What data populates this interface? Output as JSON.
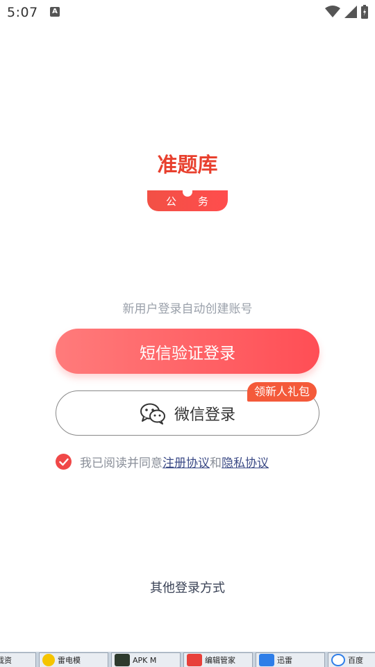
{
  "status_bar": {
    "time": "5:07",
    "notification_icon": "A"
  },
  "logo": {
    "title": "准题库",
    "tag_left": "公",
    "tag_right": "务"
  },
  "hint": "新用户登录自动创建账号",
  "sms_login_label": "短信验证登录",
  "wechat_login_label": "微信登录",
  "gift_badge": "领新人礼包",
  "agreement": {
    "prefix": "我已阅读并同意",
    "register_link": "注册协议",
    "and": "和",
    "privacy_link": "隐私协议"
  },
  "other_login": "其他登录方式",
  "taskbar": {
    "items": [
      {
        "label": "载资",
        "icon": "app-icon"
      },
      {
        "label": "雷电模",
        "icon": "ldplayer-icon"
      },
      {
        "label": "APK M",
        "icon": "android-icon"
      },
      {
        "label": "编辑管家",
        "icon": "red-app-icon"
      },
      {
        "label": "迅雷",
        "icon": "xunlei-icon"
      },
      {
        "label": "百度",
        "icon": "cloud-icon"
      }
    ]
  },
  "colors": {
    "accent": "#ff4e55",
    "badge": "#f45a3a",
    "link": "#3b4a86"
  }
}
